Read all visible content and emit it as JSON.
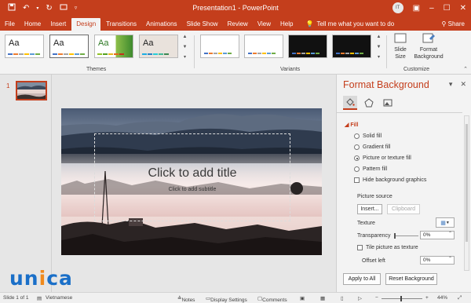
{
  "titlebar": {
    "doc_title": "Presentation1 - PowerPoint",
    "avatar_initials": "IT"
  },
  "tabs": [
    "File",
    "Home",
    "Insert",
    "Design",
    "Transitions",
    "Animations",
    "Slide Show",
    "Review",
    "View",
    "Help"
  ],
  "active_tab": "Design",
  "tell_me": "Tell me what you want to do",
  "share": "Share",
  "ribbon": {
    "themes_label": "Themes",
    "variants_label": "Variants",
    "customize_label": "Customize",
    "theme_text": "Aa",
    "slide_size": "Slide Size",
    "format_background": "Format Background"
  },
  "thumbnail": {
    "number": "1"
  },
  "slide": {
    "title_placeholder": "Click to add title",
    "subtitle_placeholder": "Click to add subtitle"
  },
  "pane": {
    "title": "Format Background",
    "fill_header": "Fill",
    "fill_options": [
      "Solid fill",
      "Gradient fill",
      "Picture or texture fill",
      "Pattern fill"
    ],
    "selected_fill": "Picture or texture fill",
    "hide_graphics": "Hide background graphics",
    "picture_source": "Picture source",
    "insert_btn": "Insert...",
    "clipboard_btn": "Clipboard",
    "texture": "Texture",
    "transparency": "Transparency",
    "transparency_value": "0%",
    "tile_picture": "Tile picture as texture",
    "offset_left": "Offset left",
    "offset_left_value": "0%",
    "apply_all": "Apply to All",
    "reset": "Reset Background"
  },
  "status": {
    "slide_count": "Slide 1 of 1",
    "language": "Vietnamese",
    "notes": "Notes",
    "display_settings": "Display Settings",
    "comments": "Comments",
    "zoom": "44%"
  },
  "colors": {
    "accent": "#c43e1c",
    "ribbon_bg": "#f3f3f3",
    "watermark_blue": "#1a6fc8",
    "watermark_orange": "#f08a1c"
  },
  "watermark": {
    "text_main": "unica"
  }
}
